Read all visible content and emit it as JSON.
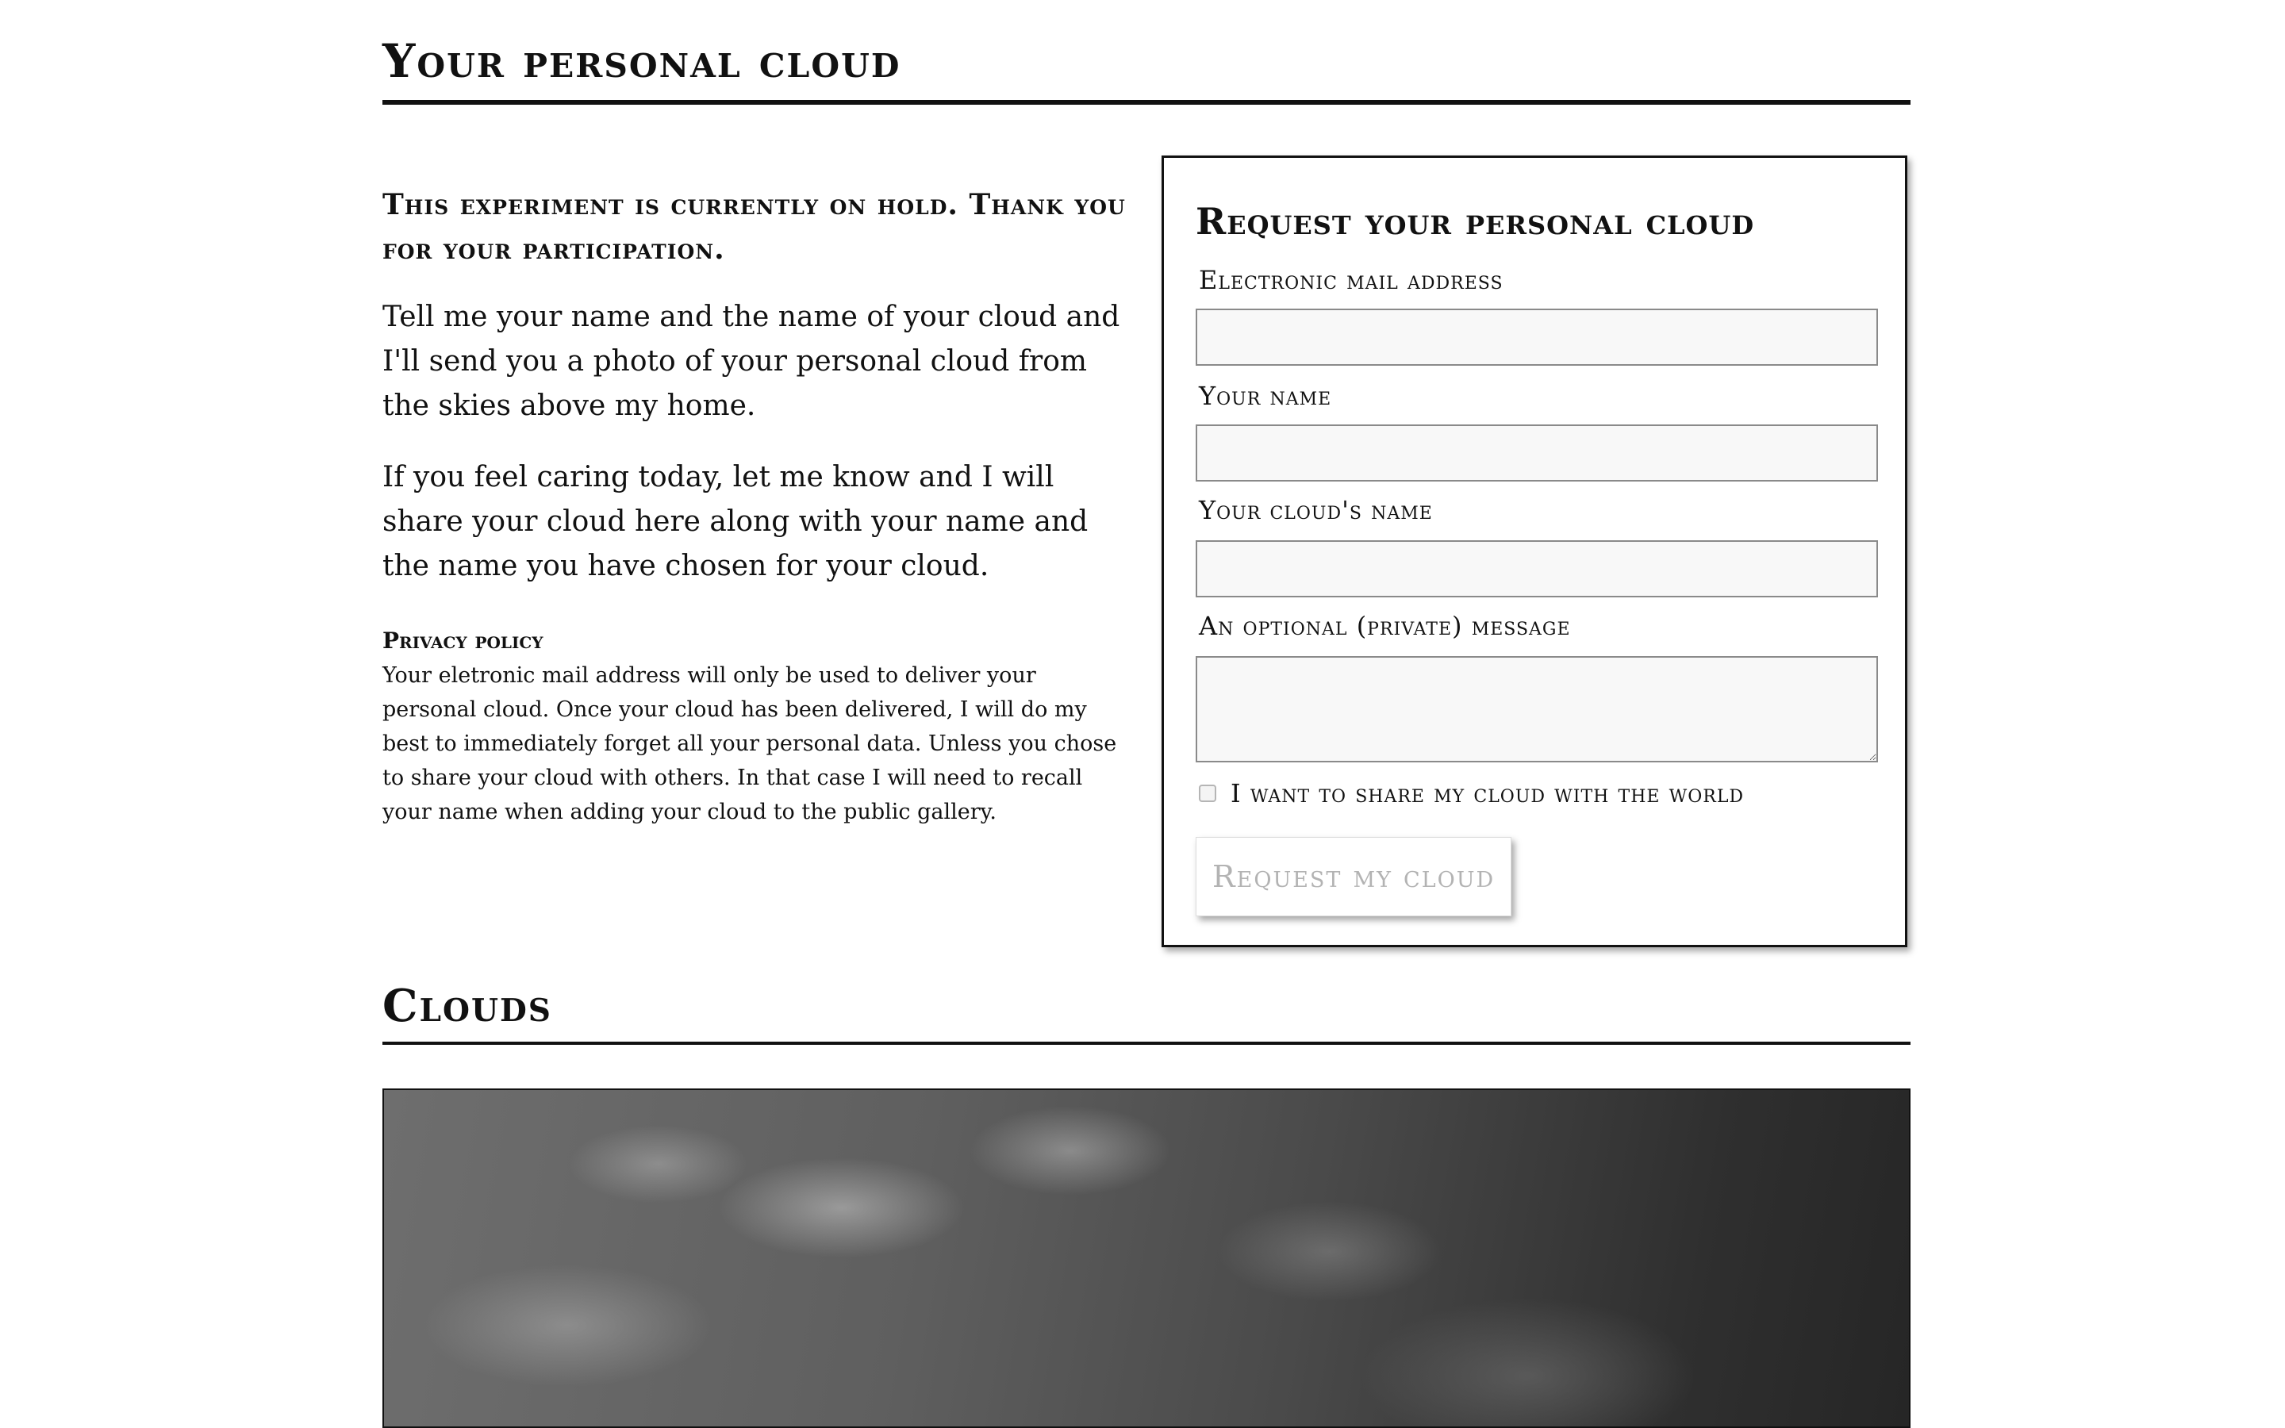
{
  "header": {
    "title": "Your personal cloud"
  },
  "intro": {
    "notice": "This experiment is currently on hold. Thank you for your participation.",
    "paragraph1": "Tell me your name and the name of your cloud and I'll send you a photo of your personal cloud from the skies above my home.",
    "paragraph2": "If you feel caring today, let me know and I will share your cloud here along with your name and the name you have chosen for your cloud.",
    "privacy_title": "Privacy policy",
    "privacy_text": "Your eletronic mail address will only be used to deliver your personal cloud. Once your cloud has been delivered, I will do my best to immediately forget all your personal data. Unless you chose to share your cloud with others. In that case I will need to recall your name when adding your cloud to the public gallery."
  },
  "form": {
    "title": "Request your personal cloud",
    "email_label": "Electronic mail address",
    "email_value": "",
    "name_label": "Your name",
    "name_value": "",
    "cloud_name_label": "Your cloud's name",
    "cloud_name_value": "",
    "message_label": "An optional (private) message",
    "message_value": "",
    "share_label": "I want to share my cloud with the world",
    "share_checked": false,
    "submit_label": "Request my cloud"
  },
  "gallery": {
    "title": "Clouds"
  }
}
